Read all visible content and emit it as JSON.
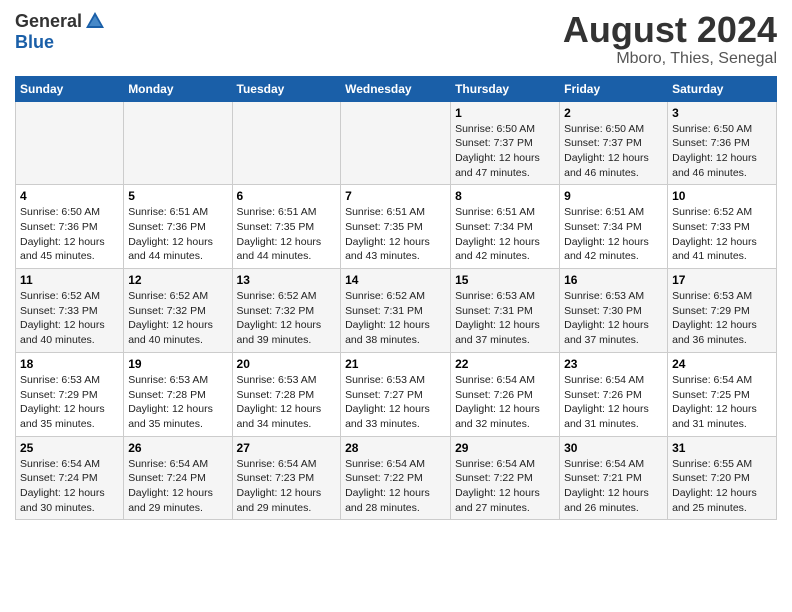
{
  "logo": {
    "general": "General",
    "blue": "Blue"
  },
  "title": "August 2024",
  "subtitle": "Mboro, Thies, Senegal",
  "days_of_week": [
    "Sunday",
    "Monday",
    "Tuesday",
    "Wednesday",
    "Thursday",
    "Friday",
    "Saturday"
  ],
  "weeks": [
    [
      {
        "day": "",
        "info": ""
      },
      {
        "day": "",
        "info": ""
      },
      {
        "day": "",
        "info": ""
      },
      {
        "day": "",
        "info": ""
      },
      {
        "day": "1",
        "sunrise": "Sunrise: 6:50 AM",
        "sunset": "Sunset: 7:37 PM",
        "daylight": "Daylight: 12 hours and 47 minutes."
      },
      {
        "day": "2",
        "sunrise": "Sunrise: 6:50 AM",
        "sunset": "Sunset: 7:37 PM",
        "daylight": "Daylight: 12 hours and 46 minutes."
      },
      {
        "day": "3",
        "sunrise": "Sunrise: 6:50 AM",
        "sunset": "Sunset: 7:36 PM",
        "daylight": "Daylight: 12 hours and 46 minutes."
      }
    ],
    [
      {
        "day": "4",
        "sunrise": "Sunrise: 6:50 AM",
        "sunset": "Sunset: 7:36 PM",
        "daylight": "Daylight: 12 hours and 45 minutes."
      },
      {
        "day": "5",
        "sunrise": "Sunrise: 6:51 AM",
        "sunset": "Sunset: 7:36 PM",
        "daylight": "Daylight: 12 hours and 44 minutes."
      },
      {
        "day": "6",
        "sunrise": "Sunrise: 6:51 AM",
        "sunset": "Sunset: 7:35 PM",
        "daylight": "Daylight: 12 hours and 44 minutes."
      },
      {
        "day": "7",
        "sunrise": "Sunrise: 6:51 AM",
        "sunset": "Sunset: 7:35 PM",
        "daylight": "Daylight: 12 hours and 43 minutes."
      },
      {
        "day": "8",
        "sunrise": "Sunrise: 6:51 AM",
        "sunset": "Sunset: 7:34 PM",
        "daylight": "Daylight: 12 hours and 42 minutes."
      },
      {
        "day": "9",
        "sunrise": "Sunrise: 6:51 AM",
        "sunset": "Sunset: 7:34 PM",
        "daylight": "Daylight: 12 hours and 42 minutes."
      },
      {
        "day": "10",
        "sunrise": "Sunrise: 6:52 AM",
        "sunset": "Sunset: 7:33 PM",
        "daylight": "Daylight: 12 hours and 41 minutes."
      }
    ],
    [
      {
        "day": "11",
        "sunrise": "Sunrise: 6:52 AM",
        "sunset": "Sunset: 7:33 PM",
        "daylight": "Daylight: 12 hours and 40 minutes."
      },
      {
        "day": "12",
        "sunrise": "Sunrise: 6:52 AM",
        "sunset": "Sunset: 7:32 PM",
        "daylight": "Daylight: 12 hours and 40 minutes."
      },
      {
        "day": "13",
        "sunrise": "Sunrise: 6:52 AM",
        "sunset": "Sunset: 7:32 PM",
        "daylight": "Daylight: 12 hours and 39 minutes."
      },
      {
        "day": "14",
        "sunrise": "Sunrise: 6:52 AM",
        "sunset": "Sunset: 7:31 PM",
        "daylight": "Daylight: 12 hours and 38 minutes."
      },
      {
        "day": "15",
        "sunrise": "Sunrise: 6:53 AM",
        "sunset": "Sunset: 7:31 PM",
        "daylight": "Daylight: 12 hours and 37 minutes."
      },
      {
        "day": "16",
        "sunrise": "Sunrise: 6:53 AM",
        "sunset": "Sunset: 7:30 PM",
        "daylight": "Daylight: 12 hours and 37 minutes."
      },
      {
        "day": "17",
        "sunrise": "Sunrise: 6:53 AM",
        "sunset": "Sunset: 7:29 PM",
        "daylight": "Daylight: 12 hours and 36 minutes."
      }
    ],
    [
      {
        "day": "18",
        "sunrise": "Sunrise: 6:53 AM",
        "sunset": "Sunset: 7:29 PM",
        "daylight": "Daylight: 12 hours and 35 minutes."
      },
      {
        "day": "19",
        "sunrise": "Sunrise: 6:53 AM",
        "sunset": "Sunset: 7:28 PM",
        "daylight": "Daylight: 12 hours and 35 minutes."
      },
      {
        "day": "20",
        "sunrise": "Sunrise: 6:53 AM",
        "sunset": "Sunset: 7:28 PM",
        "daylight": "Daylight: 12 hours and 34 minutes."
      },
      {
        "day": "21",
        "sunrise": "Sunrise: 6:53 AM",
        "sunset": "Sunset: 7:27 PM",
        "daylight": "Daylight: 12 hours and 33 minutes."
      },
      {
        "day": "22",
        "sunrise": "Sunrise: 6:54 AM",
        "sunset": "Sunset: 7:26 PM",
        "daylight": "Daylight: 12 hours and 32 minutes."
      },
      {
        "day": "23",
        "sunrise": "Sunrise: 6:54 AM",
        "sunset": "Sunset: 7:26 PM",
        "daylight": "Daylight: 12 hours and 31 minutes."
      },
      {
        "day": "24",
        "sunrise": "Sunrise: 6:54 AM",
        "sunset": "Sunset: 7:25 PM",
        "daylight": "Daylight: 12 hours and 31 minutes."
      }
    ],
    [
      {
        "day": "25",
        "sunrise": "Sunrise: 6:54 AM",
        "sunset": "Sunset: 7:24 PM",
        "daylight": "Daylight: 12 hours and 30 minutes."
      },
      {
        "day": "26",
        "sunrise": "Sunrise: 6:54 AM",
        "sunset": "Sunset: 7:24 PM",
        "daylight": "Daylight: 12 hours and 29 minutes."
      },
      {
        "day": "27",
        "sunrise": "Sunrise: 6:54 AM",
        "sunset": "Sunset: 7:23 PM",
        "daylight": "Daylight: 12 hours and 29 minutes."
      },
      {
        "day": "28",
        "sunrise": "Sunrise: 6:54 AM",
        "sunset": "Sunset: 7:22 PM",
        "daylight": "Daylight: 12 hours and 28 minutes."
      },
      {
        "day": "29",
        "sunrise": "Sunrise: 6:54 AM",
        "sunset": "Sunset: 7:22 PM",
        "daylight": "Daylight: 12 hours and 27 minutes."
      },
      {
        "day": "30",
        "sunrise": "Sunrise: 6:54 AM",
        "sunset": "Sunset: 7:21 PM",
        "daylight": "Daylight: 12 hours and 26 minutes."
      },
      {
        "day": "31",
        "sunrise": "Sunrise: 6:55 AM",
        "sunset": "Sunset: 7:20 PM",
        "daylight": "Daylight: 12 hours and 25 minutes."
      }
    ]
  ]
}
